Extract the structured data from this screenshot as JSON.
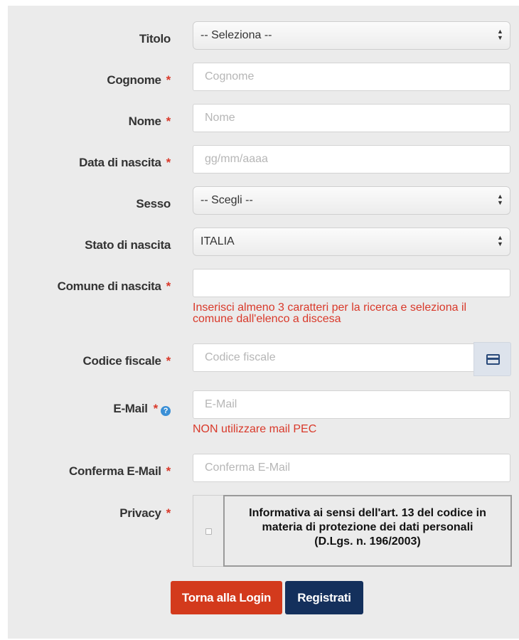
{
  "form": {
    "title": {
      "label": "Titolo",
      "value": "-- Seleziona --"
    },
    "surname": {
      "label": "Cognome",
      "placeholder": "Cognome"
    },
    "name": {
      "label": "Nome",
      "placeholder": "Nome"
    },
    "birthdate": {
      "label": "Data di nascita",
      "placeholder": "gg/mm/aaaa"
    },
    "sex": {
      "label": "Sesso",
      "value": "-- Scegli --"
    },
    "birth_country": {
      "label": "Stato di nascita",
      "value": "ITALIA"
    },
    "birth_city": {
      "label": "Comune di nascita",
      "value": "",
      "help_line1": "Inserisci almeno 3 caratteri per la ricerca e seleziona il",
      "help_line2": "comune dall'elenco a discesa"
    },
    "fiscal_code": {
      "label": "Codice fiscale",
      "placeholder": "Codice fiscale",
      "addon_icon": "card-icon"
    },
    "email": {
      "label": "E-Mail",
      "placeholder": "E-Mail",
      "help": "NON utilizzare mail PEC",
      "info_icon": "?"
    },
    "email_confirm": {
      "label": "Conferma E-Mail",
      "placeholder": "Conferma E-Mail"
    },
    "privacy": {
      "label": "Privacy",
      "checked": false,
      "text_line1": "Informativa ai sensi dell'art. 13 del codice in",
      "text_line2": "materia di protezione dei dati personali",
      "text_line3": "(D.Lgs. n. 196/2003)"
    },
    "required_mark": "*"
  },
  "buttons": {
    "back_to_login": "Torna alla Login",
    "register": "Registrati"
  },
  "colors": {
    "panel_bg": "#ebebeb",
    "required": "#d9392a",
    "btn_login": "#d33a1c",
    "btn_register": "#14305c"
  }
}
